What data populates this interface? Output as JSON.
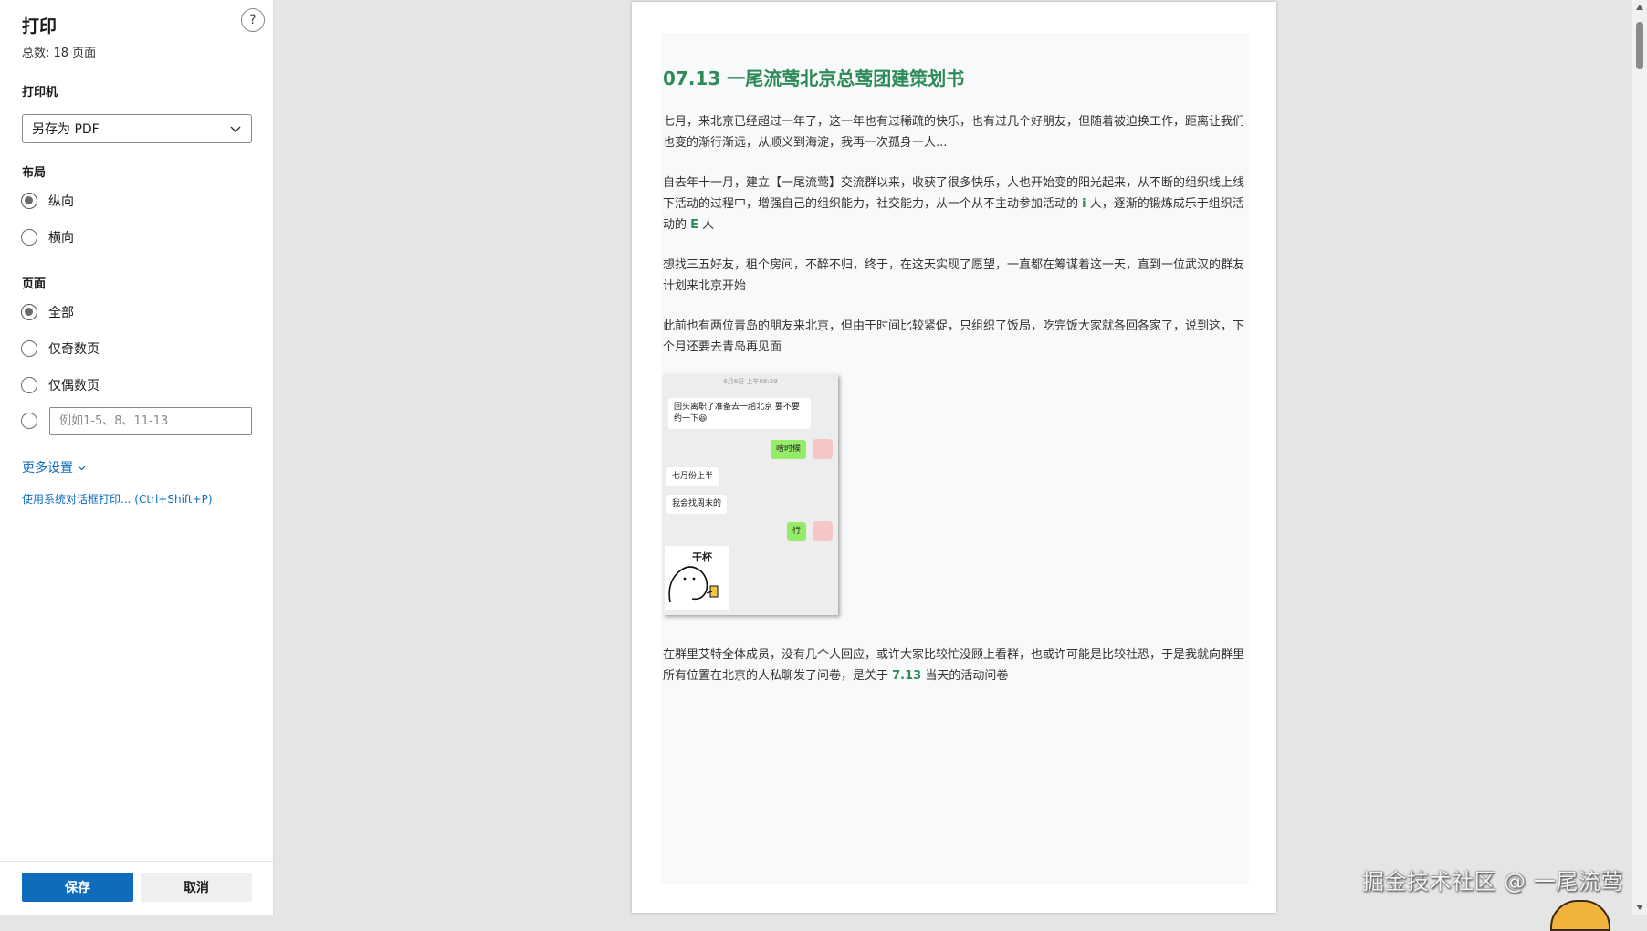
{
  "panel": {
    "title": "打印",
    "total": "总数: 18 页面",
    "help": "?",
    "printer_label": "打印机",
    "printer_value": "另存为 PDF",
    "layout_label": "布局",
    "layout_options": [
      "纵向",
      "横向"
    ],
    "layout_selected": "纵向",
    "pages_label": "页面",
    "pages_options": [
      "全部",
      "仅奇数页",
      "仅偶数页"
    ],
    "pages_selected": "全部",
    "range_placeholder": "例如1-5、8、11-13",
    "more_settings": "更多设置",
    "system_dialog": "使用系统对话框打印... (Ctrl+Shift+P)",
    "save": "保存",
    "cancel": "取消"
  },
  "preview": {
    "title": "07.13 一尾流莺北京总莺团建策划书",
    "p1": "七月，来北京已经超过一年了，这一年也有过稀疏的快乐，也有过几个好朋友，但随着被迫换工作，距离让我们也变的渐行渐远，从顺义到海淀，我再一次孤身一人...",
    "p2_a": "自去年十一月，建立【一尾流莺】交流群以来，收获了很多快乐，人也开始变的阳光起来，从不断的组织线上线下活动的过程中，增强自己的组织能力，社交能力，从一个从不主动参加活动的 ",
    "p2_i": "i",
    "p2_b": " 人，逐渐的锻炼成乐于组织活动的 ",
    "p2_e": "E",
    "p2_c": " 人",
    "p3": "想找三五好友，租个房间，不醉不归，终于，在这天实现了愿望，一直都在筹谋着这一天，直到一位武汉的群友计划来北京开始",
    "p4": "此前也有两位青岛的朋友来北京，但由于时间比较紧促，只组织了饭局，吃完饭大家就各回各家了，说到这，下个月还要去青岛再见面",
    "p5_a": "在群里艾特全体成员，没有几个人回应，或许大家比较忙没顾上看群，也或许可能是比较社恐，于是我就向群里所有位置在北京的人私聊发了问卷，是关于 ",
    "p5_date": "7.13",
    "p5_b": " 当天的活动问卷",
    "chat": {
      "time": "6月6日 上午08:29",
      "msg1": "回头离职了准备去一趟北京  要不要约一下😆",
      "msg2": "啥时候",
      "msg3": "七月份上半",
      "msg4": "我会找周末的",
      "msg5": "行",
      "sticker_text": "干杯"
    }
  },
  "watermark": "掘金技术社区 @ 一尾流莺",
  "colors": {
    "accent": "#2e8b57",
    "primary_button": "#0f6cbd"
  }
}
